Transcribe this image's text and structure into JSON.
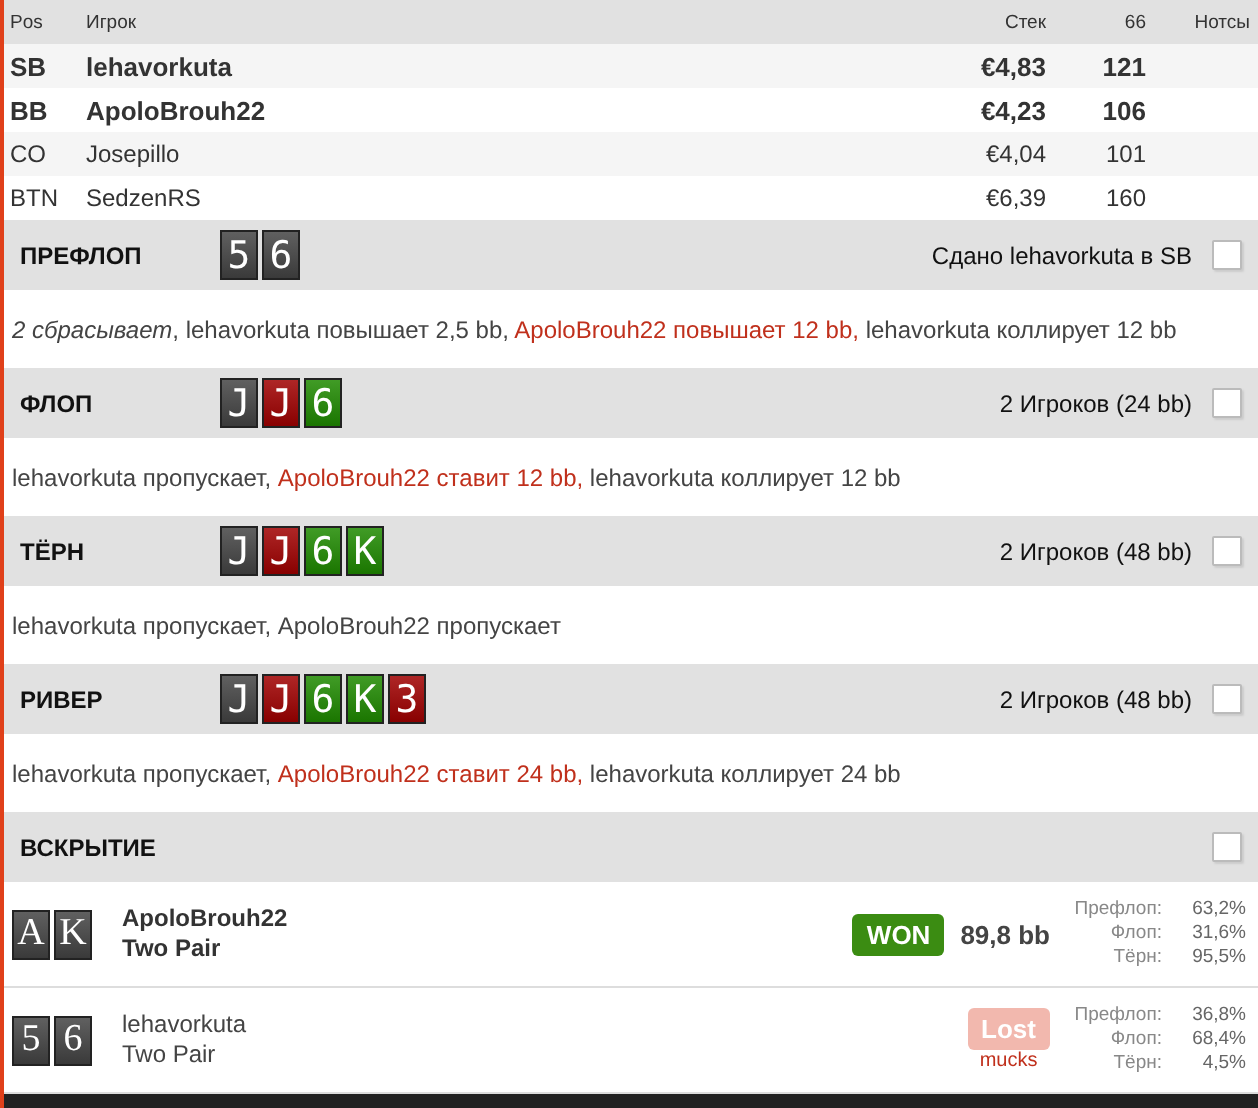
{
  "table": {
    "columns": [
      "Pos",
      "Игрок",
      "Стек",
      "66",
      "Нотсы"
    ],
    "rows": [
      {
        "pos": "SB",
        "player": "lehavorkuta",
        "stack": "€4,83",
        "bb": "121",
        "highlighted": true
      },
      {
        "pos": "BB",
        "player": "ApoloBrouh22",
        "stack": "€4,23",
        "bb": "106",
        "highlighted": true
      },
      {
        "pos": "CO",
        "player": "Josepillo",
        "stack": "€4,04",
        "bb": "101",
        "highlighted": false
      },
      {
        "pos": "BTN",
        "player": "SedzenRS",
        "stack": "€6,39",
        "bb": "160",
        "highlighted": false
      }
    ]
  },
  "streets": [
    {
      "title": "ПРЕФЛОП",
      "cards": [
        {
          "rank": "5",
          "color": "#444444"
        },
        {
          "rank": "6",
          "color": "#444444"
        }
      ],
      "info": "Сдано lehavorkuta в SB",
      "checked": false,
      "actions": [
        {
          "kind": "fold",
          "text": "2 сбрасывает"
        },
        {
          "kind": "plain",
          "text": ", lehavorkuta повышает 2,5 bb, "
        },
        {
          "kind": "aggressive",
          "text": "ApoloBrouh22 повышает 12 bb,"
        },
        {
          "kind": "plain",
          "text": " lehavorkuta коллирует 12 bb"
        }
      ]
    },
    {
      "title": "ФЛОП",
      "cards": [
        {
          "rank": "J",
          "color": "#444444"
        },
        {
          "rank": "J",
          "color": "#a00000"
        },
        {
          "rank": "6",
          "color": "#1f8a00"
        }
      ],
      "info": "2 Игроков (24 bb)",
      "checked": false,
      "actions": [
        {
          "kind": "plain",
          "text": "lehavorkuta пропускает, "
        },
        {
          "kind": "aggressive",
          "text": "ApoloBrouh22 ставит 12 bb,"
        },
        {
          "kind": "plain",
          "text": " lehavorkuta коллирует 12 bb"
        }
      ]
    },
    {
      "title": "ТЁРН",
      "cards": [
        {
          "rank": "J",
          "color": "#444444"
        },
        {
          "rank": "J",
          "color": "#a00000"
        },
        {
          "rank": "6",
          "color": "#1f8a00"
        },
        {
          "rank": "K",
          "color": "#1f8a00"
        }
      ],
      "info": "2 Игроков (48 bb)",
      "checked": false,
      "actions": [
        {
          "kind": "plain",
          "text": "lehavorkuta пропускает, ApoloBrouh22 пропускает"
        }
      ]
    },
    {
      "title": "РИВЕР",
      "cards": [
        {
          "rank": "J",
          "color": "#444444"
        },
        {
          "rank": "J",
          "color": "#a00000"
        },
        {
          "rank": "6",
          "color": "#1f8a00"
        },
        {
          "rank": "K",
          "color": "#1f8a00"
        },
        {
          "rank": "3",
          "color": "#a00000"
        }
      ],
      "info": "2 Игроков (48 bb)",
      "checked": false,
      "actions": [
        {
          "kind": "plain",
          "text": "lehavorkuta пропускает, "
        },
        {
          "kind": "aggressive",
          "text": "ApoloBrouh22 ставит 24 bb,"
        },
        {
          "kind": "plain",
          "text": " lehavorkuta коллирует 24 bb"
        }
      ]
    }
  ],
  "showdown": {
    "title": "ВСКРЫТИЕ",
    "checked": false,
    "players": [
      {
        "cards": [
          {
            "rank": "A",
            "color": "#444444"
          },
          {
            "rank": "K",
            "color": "#444444"
          }
        ],
        "name": "ApoloBrouh22",
        "hand": "Two Pair",
        "won": true,
        "badge": "WON",
        "amount": "89,8 bb",
        "equity": [
          {
            "label": "Префлоп:",
            "value": "63,2%"
          },
          {
            "label": "Флоп:",
            "value": "31,6%"
          },
          {
            "label": "Тёрн:",
            "value": "95,5%"
          }
        ]
      },
      {
        "cards": [
          {
            "rank": "5",
            "color": "#444444"
          },
          {
            "rank": "6",
            "color": "#444444"
          }
        ],
        "name": "lehavorkuta",
        "hand": "Two Pair",
        "won": false,
        "badge": "Lost",
        "note": "mucks",
        "equity": [
          {
            "label": "Префлоп:",
            "value": "36,8%"
          },
          {
            "label": "Флоп:",
            "value": "68,4%"
          },
          {
            "label": "Тёрн:",
            "value": "4,5%"
          }
        ]
      }
    ]
  }
}
